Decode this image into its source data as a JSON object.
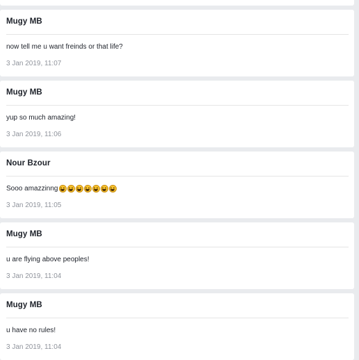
{
  "comments": [
    {
      "author": "Mugy MB",
      "text": "now tell me u want freinds or that life?",
      "time": "3 Jan 2019, 11:07"
    },
    {
      "author": "Mugy MB",
      "text": "yup so much amazing!",
      "time": "3 Jan 2019, 11:06"
    },
    {
      "author": "Nour Bzour",
      "text": "Sooo amazzinng",
      "emoji": [
        "laughing-face-icon",
        "laughing-face-icon",
        "laughing-face-icon",
        "laughing-face-icon",
        "laughing-face-icon",
        "laughing-face-icon",
        "laughing-face-icon"
      ],
      "time": "3 Jan 2019, 11:05"
    },
    {
      "author": "Mugy MB",
      "text": "u are flying above peoples!",
      "time": "3 Jan 2019, 11:04"
    },
    {
      "author": "Mugy MB",
      "text": "u have no rules!",
      "time": "3 Jan 2019, 11:04"
    }
  ],
  "colors": {
    "background": "#e9ebee",
    "card": "#ffffff",
    "author_text": "#1d2129",
    "timestamp_text": "#90949c",
    "divider": "#e5e5e5"
  }
}
